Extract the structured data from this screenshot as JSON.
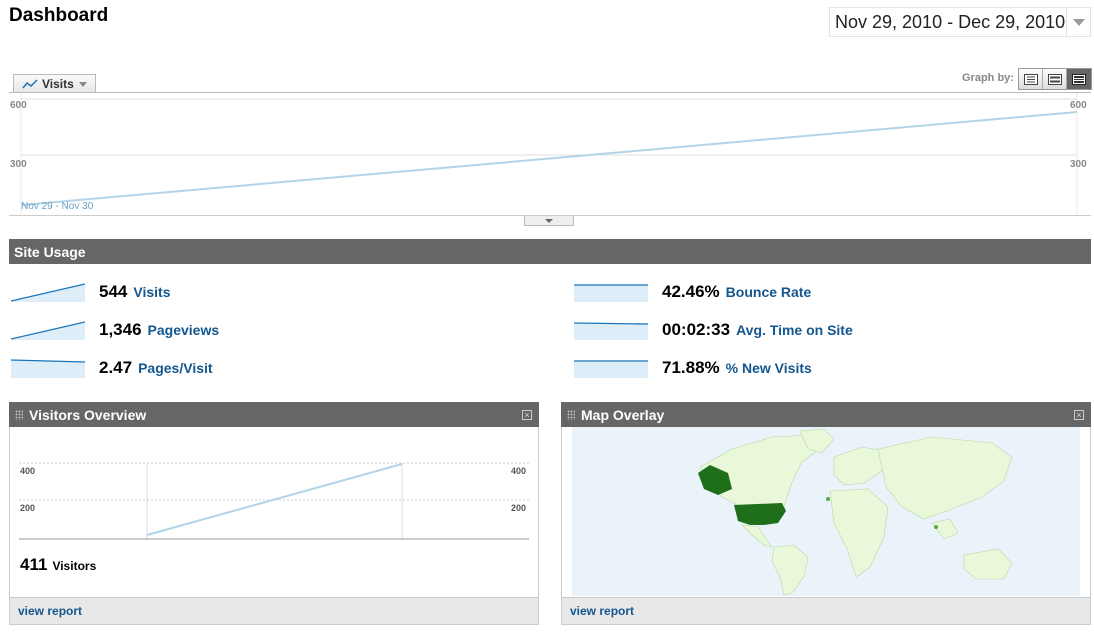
{
  "header": {
    "title": "Dashboard",
    "date_range": "Nov 29, 2010 - Dec 29, 2010"
  },
  "metric_selector": {
    "label": "Visits"
  },
  "graph_by": {
    "label": "Graph by:",
    "options": [
      "day",
      "week",
      "month"
    ],
    "active": "month"
  },
  "main_chart": {
    "y_ticks": [
      "600",
      "300"
    ],
    "x_label": "Nov 29 - Nov 30"
  },
  "site_usage": {
    "title": "Site Usage",
    "metrics": [
      {
        "value": "544",
        "name": "Visits",
        "trend": "up"
      },
      {
        "value": "1,346",
        "name": "Pageviews",
        "trend": "up"
      },
      {
        "value": "2.47",
        "name": "Pages/Visit",
        "trend": "flat"
      },
      {
        "value": "42.46%",
        "name": "Bounce Rate",
        "trend": "flat"
      },
      {
        "value": "00:02:33",
        "name": "Avg. Time on Site",
        "trend": "flat"
      },
      {
        "value": "71.88%",
        "name": "% New Visits",
        "trend": "flat"
      }
    ]
  },
  "visitors_overview": {
    "title": "Visitors Overview",
    "y_ticks": [
      "400",
      "200"
    ],
    "count": "411",
    "count_label": "Visitors",
    "link": "view report"
  },
  "map_overlay": {
    "title": "Map Overlay",
    "link": "view report"
  },
  "colors": {
    "bar": "#666666",
    "link": "#14578f",
    "line": "#b3d4e8",
    "spark": "#1a75bb",
    "map_dark": "#1f6e1a",
    "map_light": "#e8f8d8"
  },
  "icons": [
    "line-chart-icon",
    "chevron-down-icon",
    "grip-icon",
    "close-icon"
  ]
}
